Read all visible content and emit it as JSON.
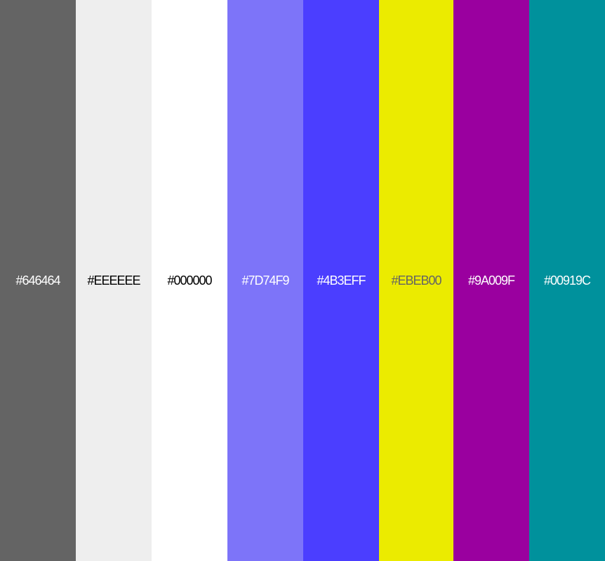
{
  "swatches": [
    {
      "label": "#646464",
      "color": "#646464",
      "text_color": "#ffffff"
    },
    {
      "label": "#EEEEEE",
      "color": "#EEEEEE",
      "text_color": "#000000"
    },
    {
      "label": "#000000",
      "color": "#FFFFFF",
      "text_color": "#000000"
    },
    {
      "label": "#7D74F9",
      "color": "#7D74F9",
      "text_color": "#ffffff"
    },
    {
      "label": "#4B3EFF",
      "color": "#4B3EFF",
      "text_color": "#ffffff"
    },
    {
      "label": "#EBEB00",
      "color": "#EBEB00",
      "text_color": "#646464"
    },
    {
      "label": "#9A009F",
      "color": "#9A009F",
      "text_color": "#ffffff"
    },
    {
      "label": "#00919C",
      "color": "#00919C",
      "text_color": "#ffffff"
    }
  ]
}
